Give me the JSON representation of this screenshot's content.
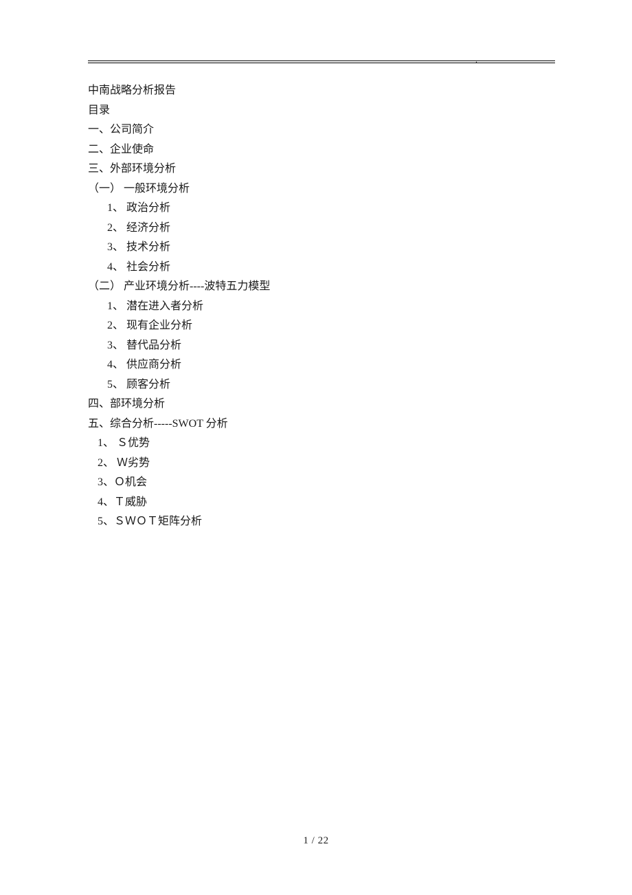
{
  "header_dot": ".",
  "content": {
    "title": "中南战略分析报告",
    "toc_label": "目录",
    "sections": [
      {
        "text": "一、公司简介",
        "indent": "indent-0"
      },
      {
        "text": "二、企业使命",
        "indent": "indent-0"
      },
      {
        "text": "三、外部环境分析",
        "indent": "indent-0"
      },
      {
        "text": "（一） 一般环境分析",
        "indent": "indent-1"
      },
      {
        "text": "1、 政治分析",
        "indent": "indent-2"
      },
      {
        "text": "2、 经济分析",
        "indent": "indent-2"
      },
      {
        "text": "3、 技术分析",
        "indent": "indent-2"
      },
      {
        "text": "4、 社会分析",
        "indent": "indent-2"
      },
      {
        "text": "（二） 产业环境分析----波特五力模型",
        "indent": "indent-1"
      },
      {
        "text": "1、 潜在进入者分析",
        "indent": "indent-2"
      },
      {
        "text": "2、 现有企业分析",
        "indent": "indent-2"
      },
      {
        "text": "3、 替代品分析",
        "indent": "indent-2"
      },
      {
        "text": "4、 供应商分析",
        "indent": "indent-2"
      },
      {
        "text": "5、 顾客分析",
        "indent": "indent-2"
      },
      {
        "text": "四、部环境分析",
        "indent": "indent-0"
      },
      {
        "text": "五、综合分析-----SWOT 分析",
        "indent": "indent-0"
      },
      {
        "text": "1、 Ｓ优势",
        "indent": "indent-3"
      },
      {
        "text": "2、 Ｗ劣势",
        "indent": "indent-3"
      },
      {
        "text": "3、Ｏ机会",
        "indent": "indent-3"
      },
      {
        "text": "4、Ｔ威胁",
        "indent": "indent-3"
      },
      {
        "text": "5、ＳＷＯＴ矩阵分析",
        "indent": "indent-3"
      }
    ]
  },
  "footer": "1  / 22"
}
